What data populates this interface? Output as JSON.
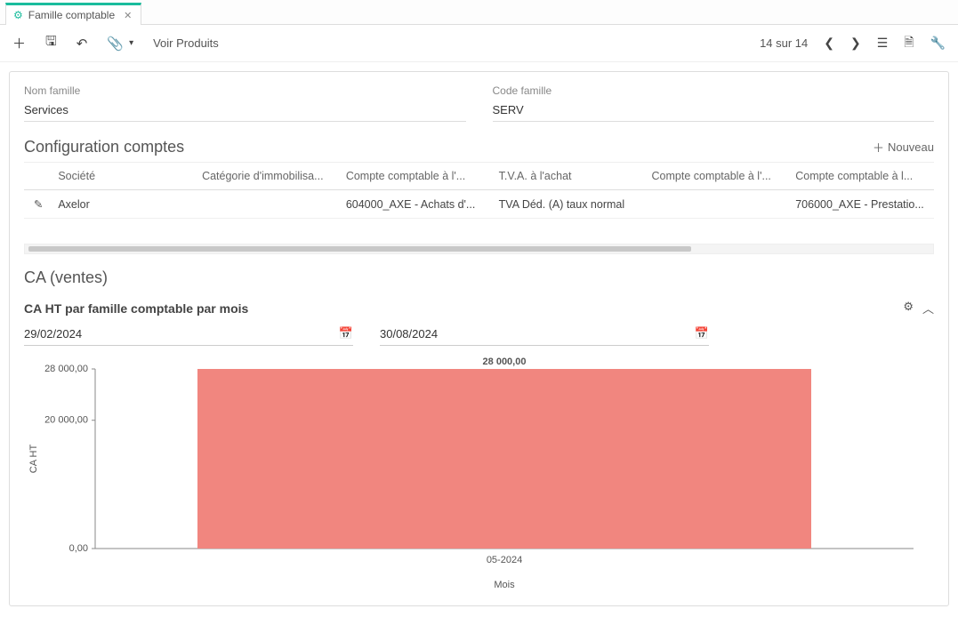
{
  "tab": {
    "title": "Famille comptable"
  },
  "toolbar": {
    "voir_produits": "Voir Produits",
    "pager": "14 sur 14"
  },
  "fields": {
    "nom_label": "Nom famille",
    "nom_value": "Services",
    "code_label": "Code famille",
    "code_value": "SERV"
  },
  "config": {
    "title": "Configuration comptes",
    "new_label": "Nouveau",
    "headers": {
      "societe": "Société",
      "categorie": "Catégorie d'immobilisa...",
      "compte_achat": "Compte comptable à l'...",
      "tva_achat": "T.V.A. à l'achat",
      "compte_achat2": "Compte comptable à l'...",
      "compte_vente": "Compte comptable à l..."
    },
    "rows": [
      {
        "societe": "Axelor",
        "categorie": "",
        "compte_achat": "604000_AXE - Achats d'...",
        "tva_achat": "TVA Déd. (A) taux normal",
        "compte_achat2": "",
        "compte_vente": "706000_AXE - Prestatio..."
      }
    ]
  },
  "ca": {
    "title": "CA (ventes)",
    "chart_title": "CA HT par famille comptable par mois",
    "date_from": "29/02/2024",
    "date_to": "30/08/2024"
  },
  "chart_data": {
    "type": "bar",
    "categories": [
      "05-2024"
    ],
    "values": [
      28000.0
    ],
    "value_labels": [
      "28 000,00"
    ],
    "title": "",
    "xlabel": "Mois",
    "ylabel": "CA HT",
    "ylim": [
      0,
      28000
    ],
    "yticks": [
      0,
      20000,
      28000
    ],
    "ytick_labels": [
      "0,00",
      "20 000,00",
      "28 000,00"
    ],
    "bar_color": "#f1867f"
  }
}
